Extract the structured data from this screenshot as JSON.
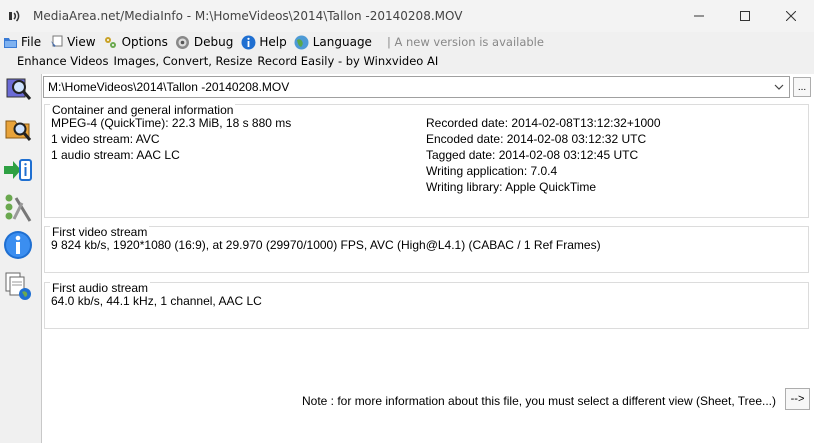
{
  "window": {
    "title": "MediaArea.net/MediaInfo - M:\\HomeVideos\\2014\\Tallon -20140208.MOV"
  },
  "menu": {
    "items": [
      {
        "label": "File",
        "icon": "folder-icon"
      },
      {
        "label": "View",
        "icon": "view-icon"
      },
      {
        "label": "Options",
        "icon": "options-icon"
      },
      {
        "label": "Debug",
        "icon": "debug-icon"
      },
      {
        "label": "Help",
        "icon": "help-icon"
      },
      {
        "label": "Language",
        "icon": "globe-icon"
      }
    ],
    "update_notice": "| A new version is available"
  },
  "adbar": {
    "items": [
      "Enhance Videos",
      "Images, Convert, Resize",
      "Record Easily - by Winxvideo AI"
    ]
  },
  "file": {
    "path": "M:\\HomeVideos\\2014\\Tallon -20140208.MOV",
    "browse_label": "..."
  },
  "general": {
    "title": "Container and general information",
    "left": [
      "MPEG-4 (QuickTime): 22.3 MiB, 18 s 880 ms",
      "1 video stream: AVC",
      "1 audio stream: AAC LC"
    ],
    "right": [
      "Recorded date: 2014-02-08T13:12:32+1000",
      "Encoded date: 2014-02-08 03:12:32 UTC",
      "Tagged date: 2014-02-08 03:12:45 UTC",
      "Writing application: 7.0.4",
      "Writing library: Apple QuickTime"
    ]
  },
  "video": {
    "title": "First video stream",
    "line": "9 824 kb/s, 1920*1080 (16:9), at 29.970 (29970/1000) FPS, AVC (High@L4.1) (CABAC / 1 Ref Frames)"
  },
  "audio": {
    "title": "First audio stream",
    "line": "64.0 kb/s, 44.1 kHz, 1 channel, AAC LC"
  },
  "footer": {
    "note": "Note : for more information about this file, you must select a different view (Sheet, Tree...)",
    "button": "-->"
  }
}
